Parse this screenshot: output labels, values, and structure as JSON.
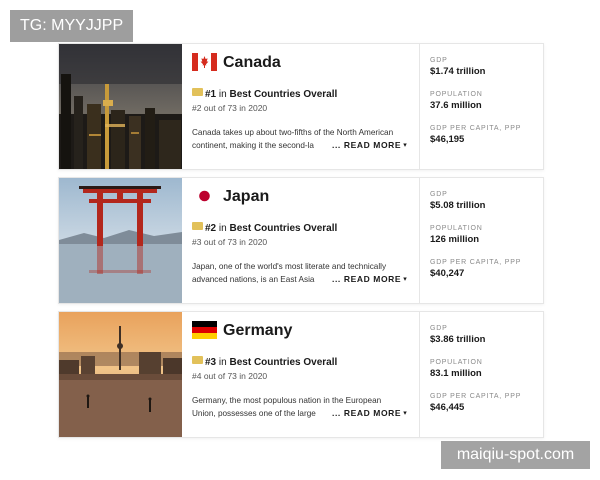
{
  "overlay": {
    "tg_label": "TG: MYYJJPP",
    "watermark": "maiqiu-spot.com"
  },
  "labels": {
    "rank_in": "in",
    "read_more": "... READ MORE",
    "gdp": "GDP",
    "population": "POPULATION",
    "gdp_per_capita": "GDP PER CAPITA, PPP"
  },
  "colors": {
    "medal": "#e2c15a",
    "canada_red": "#d52b1e",
    "japan_red": "#bc002d"
  },
  "countries": [
    {
      "name": "Canada",
      "flag_icon": "canada-flag-icon",
      "rank": "#1",
      "category": "Best Countries Overall",
      "rank_of": "#2 out of 73 in 2020",
      "desc_line1": "Canada takes up about two-fifths of the North American",
      "desc_line2": "continent, making it the second-la",
      "gdp": "$1.74 trillion",
      "population": "37.6 million",
      "gdp_per_capita": "$46,195"
    },
    {
      "name": "Japan",
      "flag_icon": "japan-flag-icon",
      "rank": "#2",
      "category": "Best Countries Overall",
      "rank_of": "#3 out of 73 in 2020",
      "desc_line1": "Japan, one of the world's most literate and technically",
      "desc_line2": "advanced nations, is an East Asia",
      "gdp": "$5.08 trillion",
      "population": "126 million",
      "gdp_per_capita": "$40,247"
    },
    {
      "name": "Germany",
      "flag_icon": "germany-flag-icon",
      "rank": "#3",
      "category": "Best Countries Overall",
      "rank_of": "#4 out of 73 in 2020",
      "desc_line1": "Germany, the most populous nation in the European",
      "desc_line2": "Union, possesses one of the large",
      "gdp": "$3.86 trillion",
      "population": "83.1 million",
      "gdp_per_capita": "$46,445"
    }
  ]
}
